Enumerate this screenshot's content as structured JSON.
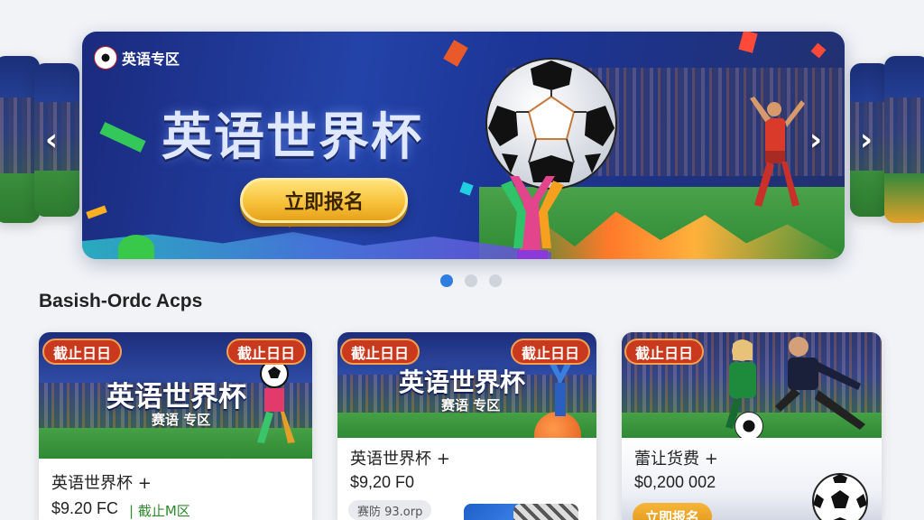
{
  "carousel": {
    "logo_text": "英语专区",
    "title": "英语世界杯",
    "cta_label": "立即报名",
    "prev_arrow": "‹",
    "next_arrow": "›",
    "slides_count": 3,
    "active_slide": 1
  },
  "section": {
    "title": "Basish-Ordc Acps"
  },
  "cards": [
    {
      "badge_left": "截止日日",
      "badge_right": "截止日日",
      "banner_title": "英语世界杯",
      "banner_sub": "赛语 专区",
      "title": "英语世界杯 +",
      "price": "$9.20 FC",
      "meta": "| 截止M区"
    },
    {
      "badge_left": "截止日日",
      "badge_right": "截止日日",
      "banner_title": "英语世界杯",
      "banner_sub": "赛语 专区",
      "title": "英语世界杯 +",
      "price": "$9,20 F0",
      "pill": "赛防 93.orp"
    },
    {
      "badge_left": "截止日日",
      "title": "蕾让货费 +",
      "price": "$0,200 002",
      "button": "立即报名"
    }
  ],
  "colors": {
    "accent_blue": "#2f7de0",
    "badge_red": "#c8391d",
    "cta_gold": "#f7c23a"
  }
}
